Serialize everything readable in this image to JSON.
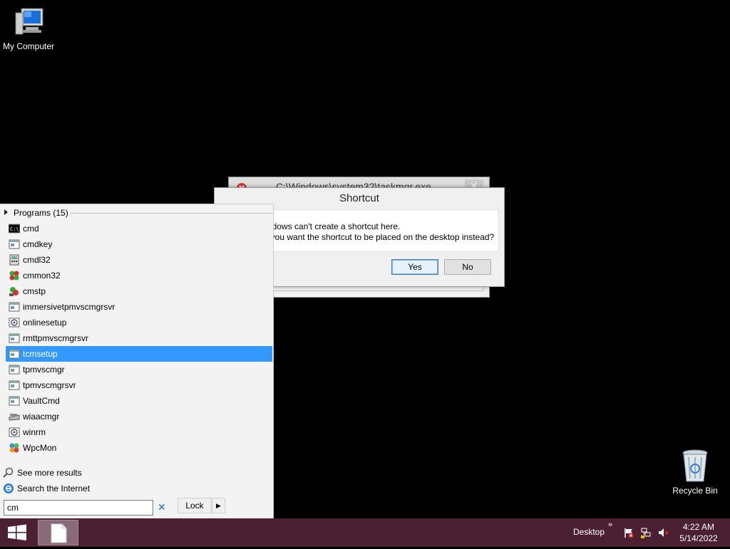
{
  "desktop": {
    "icons": [
      {
        "label": "My Computer"
      },
      {
        "label": "Recycle Bin"
      }
    ]
  },
  "background_window": {
    "title": "C:\\Windows\\system32\\taskmgr.exe"
  },
  "dialog": {
    "title": "Shortcut",
    "message_line1": "Windows can't create a shortcut here.",
    "message_line2": "Do you want the shortcut to be placed on the desktop instead?",
    "yes_label": "Yes",
    "no_label": "No"
  },
  "start_panel": {
    "programs_header": "Programs (15)",
    "results": [
      {
        "label": "cmd",
        "icon": "console-icon"
      },
      {
        "label": "cmdkey",
        "icon": "app-window-icon"
      },
      {
        "label": "cmdl32",
        "icon": "dialer-icon"
      },
      {
        "label": "cmmon32",
        "icon": "monitor-icon"
      },
      {
        "label": "cmstp",
        "icon": "installer-icon"
      },
      {
        "label": "immersivetpmvscmgrsvr",
        "icon": "app-window-icon"
      },
      {
        "label": "onlinesetup",
        "icon": "setup-icon"
      },
      {
        "label": "rmttpmvscmgrsvr",
        "icon": "app-window-icon"
      },
      {
        "label": "tcmsetup",
        "icon": "app-window-icon",
        "selected": true
      },
      {
        "label": "tpmvscmgr",
        "icon": "app-window-icon"
      },
      {
        "label": "tpmvscmgrsvr",
        "icon": "app-window-icon"
      },
      {
        "label": "VaultCmd",
        "icon": "app-window-icon"
      },
      {
        "label": "wiaacmgr",
        "icon": "scanner-icon"
      },
      {
        "label": "winrm",
        "icon": "setup-icon"
      },
      {
        "label": "WpcMon",
        "icon": "family-safety-icon"
      }
    ],
    "see_more": "See more results",
    "search_internet": "Search the Internet",
    "search_value": "cm",
    "lock_label": "Lock"
  },
  "taskbar": {
    "desktop_label": "Desktop",
    "chevron": "»",
    "time": "4:22 AM",
    "date": "5/14/2022"
  },
  "colors": {
    "taskbar": "#4a2032",
    "selection": "#3399ff",
    "desktop": "#000000"
  }
}
